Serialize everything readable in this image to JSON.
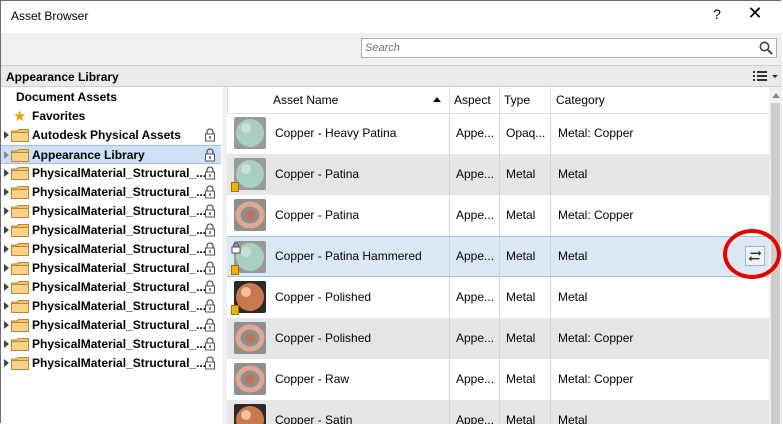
{
  "window": {
    "title": "Asset Browser",
    "help_label": "?",
    "close_label": "✕"
  },
  "search": {
    "placeholder": "Search",
    "value": ""
  },
  "library_header": {
    "title": "Appearance Library"
  },
  "tree": [
    {
      "label": "Document Assets",
      "kind": "plain",
      "locked": false
    },
    {
      "label": "Favorites",
      "kind": "favorite",
      "locked": false
    },
    {
      "label": "Autodesk Physical Assets",
      "kind": "folder",
      "locked": true
    },
    {
      "label": "Appearance Library",
      "kind": "folder",
      "locked": true,
      "selected": true
    },
    {
      "label": "PhysicalMaterial_Structural_...",
      "kind": "folder",
      "locked": true
    },
    {
      "label": "PhysicalMaterial_Structural_...",
      "kind": "folder",
      "locked": true
    },
    {
      "label": "PhysicalMaterial_Structural_...",
      "kind": "folder",
      "locked": true
    },
    {
      "label": "PhysicalMaterial_Structural_...",
      "kind": "folder",
      "locked": true
    },
    {
      "label": "PhysicalMaterial_Structural_...",
      "kind": "folder",
      "locked": true
    },
    {
      "label": "PhysicalMaterial_Structural_...",
      "kind": "folder",
      "locked": true
    },
    {
      "label": "PhysicalMaterial_Structural_...",
      "kind": "folder",
      "locked": true
    },
    {
      "label": "PhysicalMaterial_Structural_...",
      "kind": "folder",
      "locked": true
    },
    {
      "label": "PhysicalMaterial_Structural_...",
      "kind": "folder",
      "locked": true
    },
    {
      "label": "PhysicalMaterial_Structural_...",
      "kind": "folder",
      "locked": true
    },
    {
      "label": "PhysicalMaterial_Structural_...",
      "kind": "folder",
      "locked": true
    }
  ],
  "columns": {
    "name": "Asset Name",
    "aspect": "Aspect",
    "type": "Type",
    "category": "Category"
  },
  "assets": [
    {
      "name": "Copper - Heavy Patina",
      "aspect": "Appe...",
      "type": "Opaq...",
      "category": "Metal: Copper",
      "thumb": "patina-sphere"
    },
    {
      "name": "Copper - Patina",
      "aspect": "Appe...",
      "type": "Metal",
      "category": "Metal",
      "thumb": "patina-sphere-badge"
    },
    {
      "name": "Copper - Patina",
      "aspect": "Appe...",
      "type": "Metal",
      "category": "Metal: Copper",
      "thumb": "copper-ring"
    },
    {
      "name": "Copper - Patina Hammered",
      "aspect": "Appe...",
      "type": "Metal",
      "category": "Metal",
      "thumb": "patina-sphere-badge",
      "selected": true
    },
    {
      "name": "Copper - Polished",
      "aspect": "Appe...",
      "type": "Metal",
      "category": "Metal",
      "thumb": "copper-sphere-badge"
    },
    {
      "name": "Copper - Polished",
      "aspect": "Appe...",
      "type": "Metal",
      "category": "Metal: Copper",
      "thumb": "copper-ring"
    },
    {
      "name": "Copper - Raw",
      "aspect": "Appe...",
      "type": "Metal",
      "category": "Metal: Copper",
      "thumb": "copper-ring"
    },
    {
      "name": "Copper - Satin",
      "aspect": "Appe...",
      "type": "Metal",
      "category": "Metal",
      "thumb": "copper-sphere"
    }
  ],
  "colors": {
    "selection": "#cde0f7",
    "annotation": "#e60000",
    "folder": "#f5c56b",
    "patina": "#a8cfc0",
    "copper": "#c87a4e"
  }
}
